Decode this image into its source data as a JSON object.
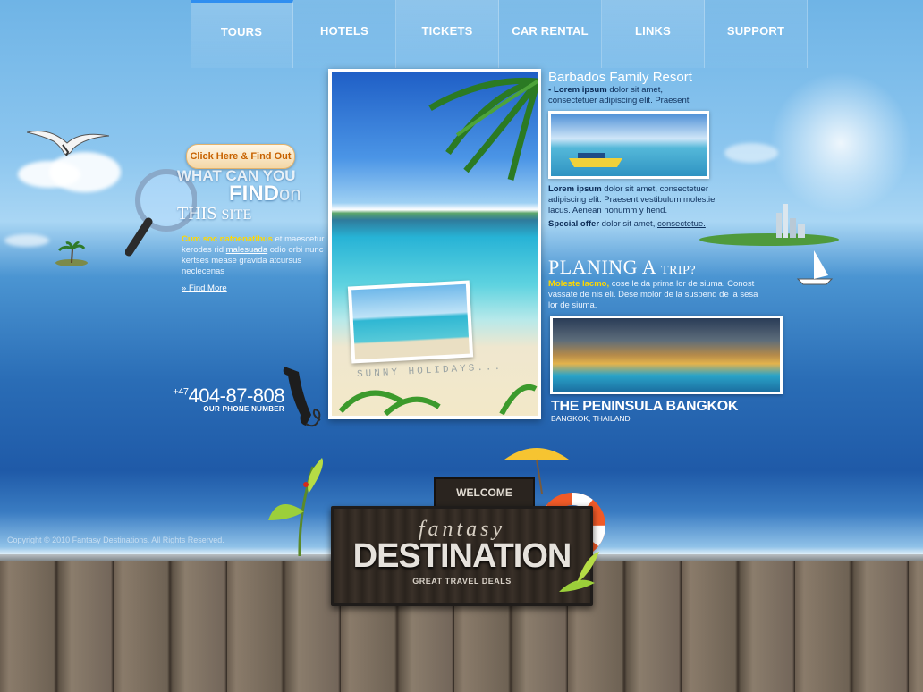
{
  "nav": {
    "items": [
      "TOURS",
      "HOTELS",
      "TICKETS",
      "CAR RENTAL",
      "LINKS",
      "SUPPORT"
    ]
  },
  "left": {
    "cta_label": "Click Here & Find Out",
    "find_line1": "WHAT CAN YOU",
    "find_word": "FIND",
    "find_on": "on",
    "find_line2a": "THIS",
    "find_line2b": "SITE",
    "body_highlight": "Cum soc natoenatibus",
    "body_text1": "et maescetur kerodes rid",
    "body_link": "malesuada",
    "body_text2": "odio orbi nunc kertses mease gravida atcursus neclecenas",
    "more_label": "Find More",
    "phone_prefix": "+47",
    "phone_number": "404-87-808",
    "phone_caption": "OUR PHONE NUMBER"
  },
  "center": {
    "photo_caption": "SUNNY HOLIDAYS..."
  },
  "right": {
    "resort_title": "Barbados Family Resort",
    "resort_bold": "Lorem ipsum",
    "resort_text": "dolor sit amet, consectetuer adipiscing elit. Praesent",
    "desc_bold": "Lorem ipsum",
    "desc_text": "dolor sit amet, consectetuer adipiscing elit. Praesent vestibulum molestie lacus. Aenean nonumm y hend.",
    "special_bold": "Special offer",
    "special_text": "dolor sit amet,",
    "special_link": "consectetue.",
    "plan_title": "PLANING A",
    "plan_small": "TRIP?",
    "plan_highlight": "Moleste lacmo,",
    "plan_text": "cose le da prima lor de siuma. Conost vassate de nis eli. Dese molor de la suspend de  la sesa lor de siuma.",
    "hotel_name": "THE PENINSULA BANGKOK",
    "hotel_location": "BANGKOK, THAILAND"
  },
  "footer": {
    "copyright": "Copyright © 2010 Fantasy Destinations. All Rights Reserved.",
    "welcome": "WELCOME",
    "sign_script": "fantasy",
    "sign_main": "DESTINATION",
    "sign_tagline": "GREAT TRAVEL DEALS"
  },
  "colors": {
    "accent_yellow": "#ffd800",
    "nav_accent": "#2f8ef0",
    "cta_text": "#c76200"
  }
}
